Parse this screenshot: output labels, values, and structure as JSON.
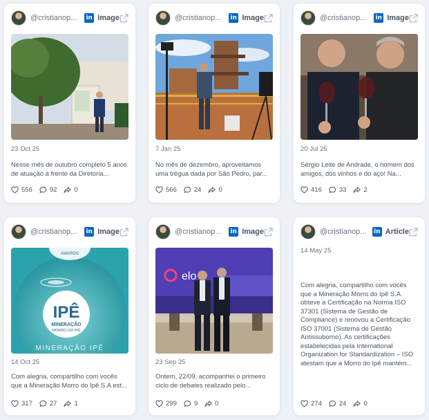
{
  "cards": [
    {
      "handle": "@cristianop...",
      "type": "Image",
      "date": "23 Oct 25",
      "text": "Nesse mês de outubro completo 5 anos de atuação à frente da Diretoria...",
      "likes": "556",
      "comments": "92",
      "shares": "0"
    },
    {
      "handle": "@cristianop...",
      "type": "Image",
      "date": "7 Jan 25",
      "text": "No mês de dezembro, aproveitamos uma trégua dada por São Pedro, par...",
      "likes": "566",
      "comments": "24",
      "shares": "0"
    },
    {
      "handle": "@cristianop...",
      "type": "Image",
      "date": "20 Jul 25",
      "text": "Sérgio Leite de Andrade, o homem dos amigos, dos vinhos e do aço! Na...",
      "likes": "416",
      "comments": "33",
      "shares": "2"
    },
    {
      "handle": "@cristianop...",
      "type": "Image",
      "date": "14 Oct 25",
      "text": "Com alegria, compartilho com vocês que a Mineração Morro do Ipê S.A est...",
      "likes": "317",
      "comments": "27",
      "shares": "1",
      "image_text": {
        "title": "IPÊ",
        "sub": "MINERAÇÃO",
        "sub2": "MORRO DO IPÊ",
        "footer": "MINERAÇÃO IPÊ",
        "badge": "AWARDS"
      }
    },
    {
      "handle": "@cristianop...",
      "type": "Image",
      "date": "23 Sep 25",
      "text": "Ontem, 22/09, acompanhei o primeiro ciclo de debates realizado pelo...",
      "likes": "299",
      "comments": "9",
      "shares": "0",
      "image_text": {
        "brand": "elo"
      }
    },
    {
      "handle": "@cristianop...",
      "type": "Article",
      "date": "14 May 25",
      "text": "Com alegria, compartilho com vocês que a Mineração Morro do Ipê S.A obteve a Certificação na Norma ISO 37301 (Sistema de Gestão de Compliance) e renovou a Certificação ISO 37001 (Sistema de Gestão Antissuborno). As certificações estabelecidas pela International Organization for Standardization – ISO atestam que a Morro do Ipê mantém...",
      "likes": "274",
      "comments": "24",
      "shares": "0"
    }
  ],
  "icons": {
    "network": "linkedin-icon",
    "external": "external-link-icon",
    "like": "heart-icon",
    "comment": "comment-icon",
    "share": "share-icon"
  },
  "colors": {
    "linkedin": "#0a66c2",
    "background": "#eef1f5"
  }
}
